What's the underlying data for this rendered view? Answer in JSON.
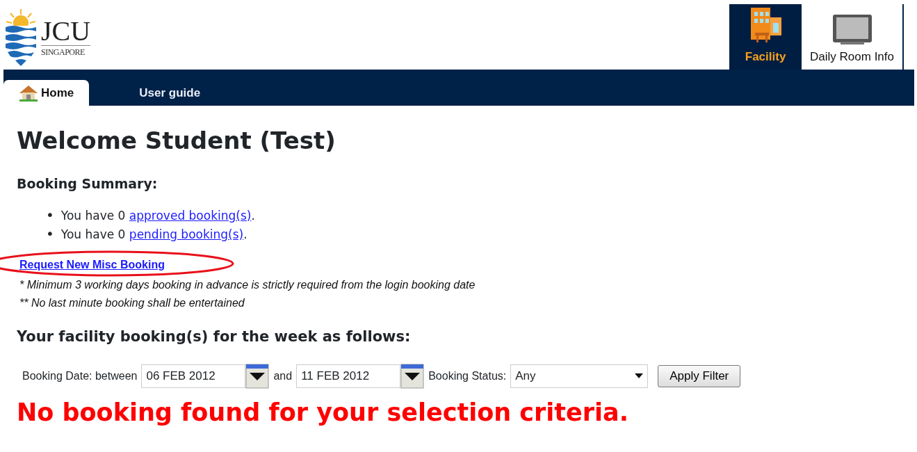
{
  "header": {
    "logo": {
      "name": "JCU",
      "subtitle": "SINGAPORE"
    },
    "modules": [
      {
        "label": "Facility",
        "selected": true,
        "kind": "building"
      },
      {
        "label": "Daily Room Info",
        "selected": false,
        "kind": "tv"
      }
    ]
  },
  "nav": {
    "tabs": [
      {
        "label": "Home",
        "selected": true,
        "kind": "home"
      },
      {
        "label": "User guide",
        "selected": false,
        "kind": "text"
      }
    ]
  },
  "welcome": "Welcome Student (Test)",
  "summary": {
    "title": "Booking Summary:",
    "items": [
      {
        "bullet": "•",
        "text": "You have 0 ",
        "link": "approved booking(s)",
        "after": "."
      },
      {
        "bullet": "•",
        "text": "You have 0 ",
        "link": "pending booking(s)",
        "after": "."
      }
    ]
  },
  "request_link": "Request New Misc Booking",
  "notes": [
    "* Minimum 3 working days booking in advance is strictly required from the login booking date",
    "** No last minute booking shall be entertained"
  ],
  "week_title": "Your facility booking(s) for the week as follows:",
  "filter": {
    "date_label": "Booking Date: between",
    "from": "06 FEB 2012",
    "and_label": "and",
    "to": "11 FEB 2012",
    "status_label": "Booking Status:",
    "status": "Any",
    "button": "Apply Filter"
  },
  "message": "No booking found for your selection criteria."
}
